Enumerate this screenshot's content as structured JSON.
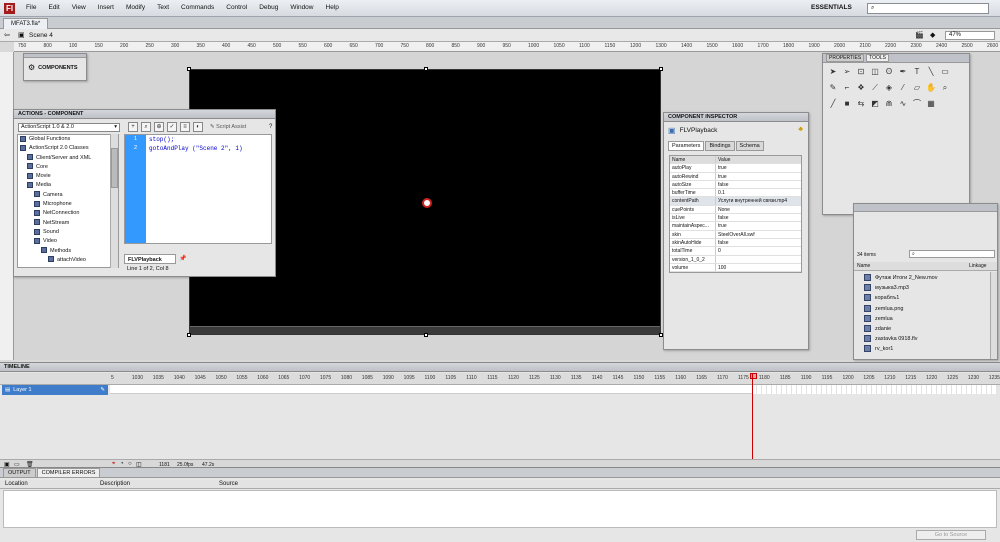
{
  "menubar": {
    "logo": "Fl",
    "items": [
      "File",
      "Edit",
      "View",
      "Insert",
      "Modify",
      "Text",
      "Commands",
      "Control",
      "Debug",
      "Window",
      "Help"
    ],
    "workspace": "ESSENTIALS",
    "search_placeholder": ""
  },
  "doc_tab": "MFAT3.fla*",
  "scene": {
    "label": "Scene 4",
    "zoom": "47%"
  },
  "ruler_ticks": [
    "750",
    "800",
    "100",
    "150",
    "200",
    "250",
    "300",
    "350",
    "400",
    "450",
    "500",
    "550",
    "600",
    "650",
    "700",
    "750",
    "800",
    "850",
    "900",
    "950",
    "1000",
    "1050",
    "1100",
    "1150",
    "1200",
    "1300",
    "1400",
    "1500",
    "1600",
    "1700",
    "1800",
    "1900",
    "2000",
    "2100",
    "2200",
    "2300",
    "2400",
    "2500",
    "2600",
    "2700"
  ],
  "components_panel": {
    "label": "COMPONENTS"
  },
  "actions": {
    "title": "ACTIONS - COMPONENT",
    "version": "ActionScript 1.0 & 2.0",
    "script_assist": "Script Assist",
    "tree": [
      {
        "label": "Global Functions",
        "indent": 1
      },
      {
        "label": "ActionScript 2.0 Classes",
        "indent": 1
      },
      {
        "label": "Client/Server and XML",
        "indent": 2
      },
      {
        "label": "Core",
        "indent": 2
      },
      {
        "label": "Movie",
        "indent": 2
      },
      {
        "label": "Media",
        "indent": 2
      },
      {
        "label": "Camera",
        "indent": 3
      },
      {
        "label": "Microphone",
        "indent": 3
      },
      {
        "label": "NetConnection",
        "indent": 3
      },
      {
        "label": "NetStream",
        "indent": 3
      },
      {
        "label": "Sound",
        "indent": 3
      },
      {
        "label": "Video",
        "indent": 3
      },
      {
        "label": "Methods",
        "indent": 4
      },
      {
        "label": "attachVideo",
        "indent": 5
      }
    ],
    "line_numbers": [
      "1",
      "2"
    ],
    "code": [
      "stop();",
      "gotoAndPlay (\"Scene 2\", 1)"
    ],
    "script_tab": "FLVPlayback",
    "status": "Line 1 of 2, Col 8"
  },
  "component_inspector": {
    "title": "COMPONENT INSPECTOR",
    "component": "FLVPlayback",
    "tabs": [
      "Parameters",
      "Bindings",
      "Schema"
    ],
    "columns": [
      "Name",
      "Value"
    ],
    "rows": [
      [
        "autoPlay",
        "true"
      ],
      [
        "autoRewind",
        "true"
      ],
      [
        "autoSize",
        "false"
      ],
      [
        "bufferTime",
        "0.1"
      ],
      [
        "contentPath",
        "Услуги внутренней связи.mp4"
      ],
      [
        "cuePoints",
        "None"
      ],
      [
        "isLive",
        "false"
      ],
      [
        "maintainAspec...",
        "true"
      ],
      [
        "skin",
        "SteelOverAll.swf"
      ],
      [
        "skinAutoHide",
        "false"
      ],
      [
        "totalTime",
        "0"
      ],
      [
        "version_1_0_2",
        ""
      ],
      [
        "volume",
        "100"
      ]
    ]
  },
  "tools_panel": {
    "tabs": [
      "PROPERTIES",
      "TOOLS"
    ]
  },
  "library": {
    "count": "34 items",
    "header_name": "Name",
    "header_linkage": "Linkage",
    "items": [
      "Футаж Итоги 2_New.mov",
      "музыка3.mp3",
      "кораблъ1",
      "zemlua.png",
      "zemlua",
      "zdanie",
      "zastavka 0918.flv",
      "rv_kor1"
    ]
  },
  "timeline": {
    "title": "TIMELINE",
    "layer": "Layer 1",
    "frame_numbers": [
      "5",
      "1030",
      "1035",
      "1040",
      "1045",
      "1050",
      "1055",
      "1060",
      "1065",
      "1070",
      "1075",
      "1080",
      "1085",
      "1090",
      "1095",
      "1100",
      "1105",
      "1110",
      "1115",
      "1120",
      "1125",
      "1130",
      "1135",
      "1140",
      "1145",
      "1150",
      "1155",
      "1160",
      "1165",
      "1170",
      "1175",
      "1180",
      "1185",
      "1190",
      "1195",
      "1200",
      "1205",
      "1210",
      "1215",
      "1220",
      "1225",
      "1230",
      "1235"
    ],
    "current_frame": "1181",
    "fps": "25.0fps",
    "time": "47.2s"
  },
  "output": {
    "tabs": [
      "OUTPUT",
      "COMPILER ERRORS"
    ],
    "columns": [
      "Location",
      "Description",
      "Source"
    ],
    "go_to_source": "Go to Source"
  },
  "colors": {
    "stage": "#000000",
    "playhead": "#cc0000",
    "gutter": "#3399ff"
  }
}
